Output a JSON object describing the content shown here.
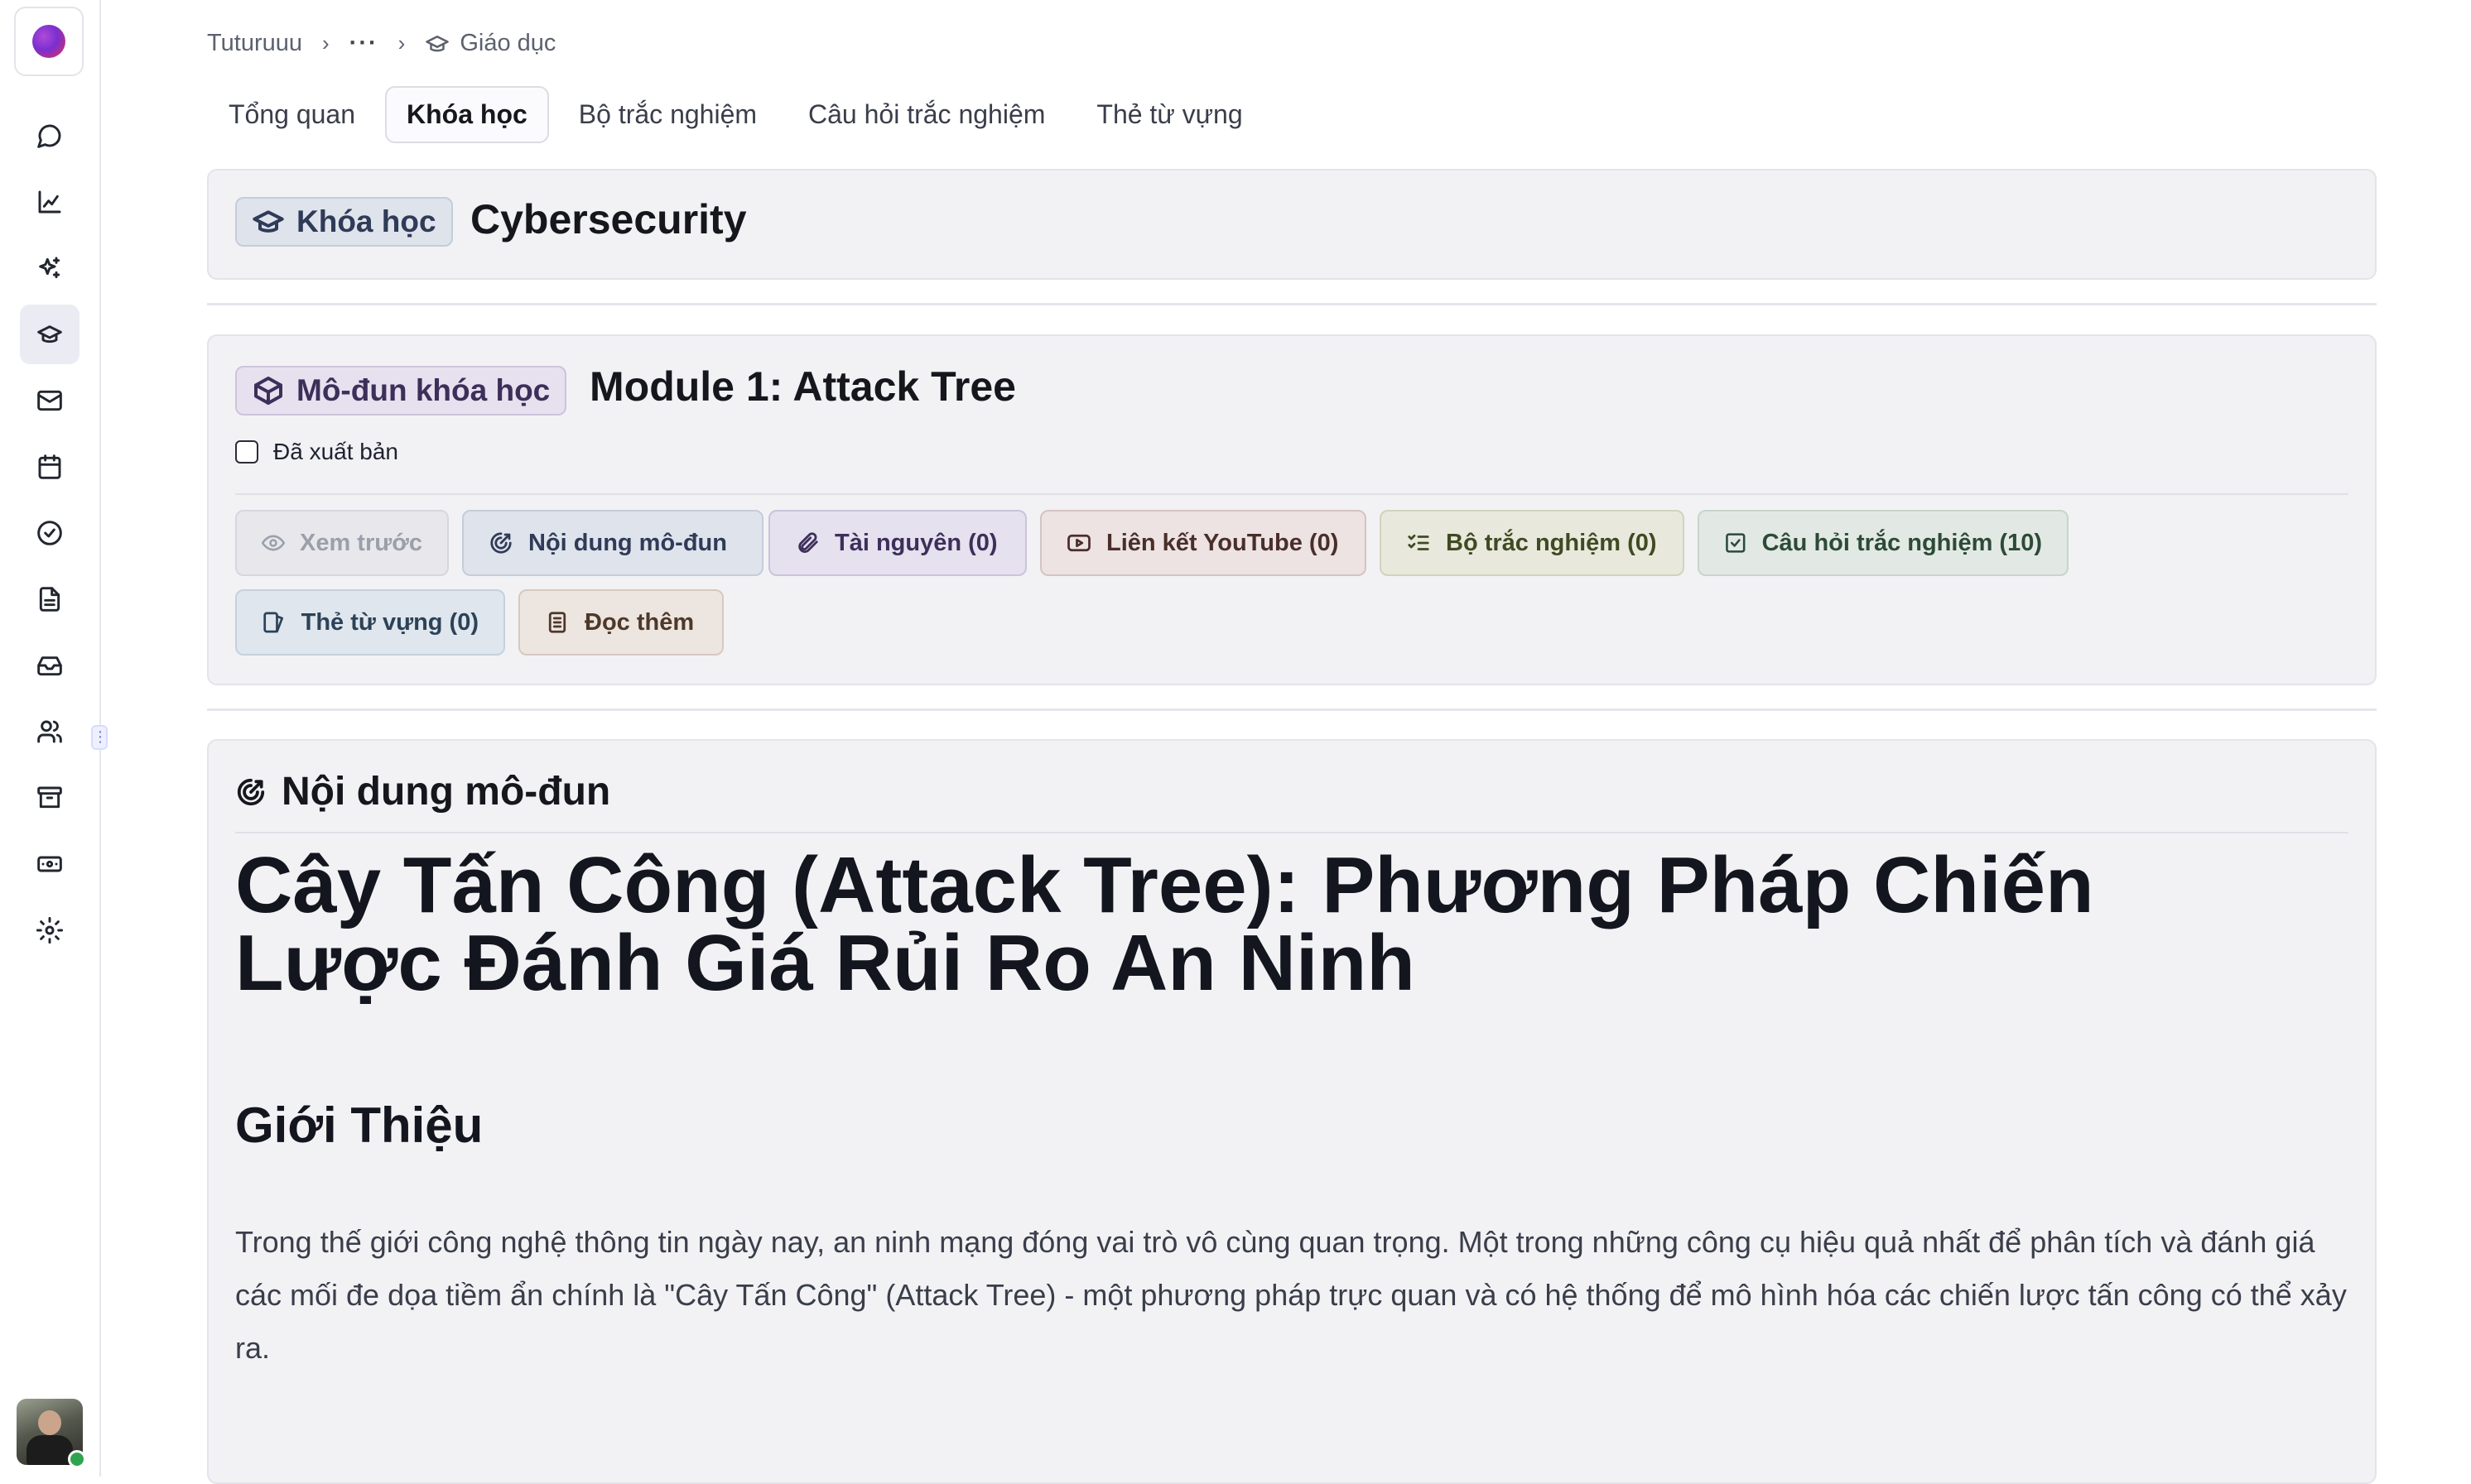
{
  "breadcrumb": {
    "root": "Tuturuuu",
    "more": "···",
    "current": "Giáo dục",
    "current_icon": "graduation-cap-icon"
  },
  "tabs": [
    {
      "label": "Tổng quan",
      "active": false
    },
    {
      "label": "Khóa học",
      "active": true
    },
    {
      "label": "Bộ trắc nghiệm",
      "active": false
    },
    {
      "label": "Câu hỏi trắc nghiệm",
      "active": false
    },
    {
      "label": "Thẻ từ vựng",
      "active": false
    }
  ],
  "course": {
    "badge": "Khóa học",
    "title": "Cybersecurity"
  },
  "module": {
    "badge": "Mô-đun khóa học",
    "title": "Module 1: Attack Tree",
    "published_label": "Đã xuất bản",
    "published": false,
    "buttons": {
      "preview": "Xem trước",
      "content": "Nội dung mô-đun",
      "resources": "Tài nguyên (0)",
      "youtube": "Liên kết YouTube (0)",
      "quiz_sets": "Bộ trắc nghiệm (0)",
      "quizzes": "Câu hỏi trắc nghiệm (10)",
      "flashcards": "Thẻ từ vựng (0)",
      "extra_reading": "Đọc thêm"
    }
  },
  "content": {
    "section_title": "Nội dung mô-đun",
    "h1": "Cây Tấn Công (Attack Tree): Phương Pháp Chiến Lược Đánh Giá Rủi Ro An Ninh",
    "h2": "Giới Thiệu",
    "paragraph": "Trong thế giới công nghệ thông tin ngày nay, an ninh mạng đóng vai trò vô cùng quan trọng. Một trong những công cụ hiệu quả nhất để phân tích và đánh giá các mối đe dọa tiềm ẩn chính là \"Cây Tấn Công\" (Attack Tree) - một phương pháp trực quan và có hệ thống để mô hình hóa các chiến lược tấn công có thể xảy ra."
  },
  "colors": {
    "accent": "#2f3b57",
    "online": "#2ea44f"
  },
  "sidebar_icons": [
    "chat-icon",
    "chart-icon",
    "sparkles-icon",
    "graduation-cap-icon",
    "mail-icon",
    "calendar-icon",
    "check-circle-icon",
    "document-icon",
    "inbox-icon",
    "users-icon",
    "archive-icon",
    "ticket-icon",
    "settings-icon"
  ]
}
